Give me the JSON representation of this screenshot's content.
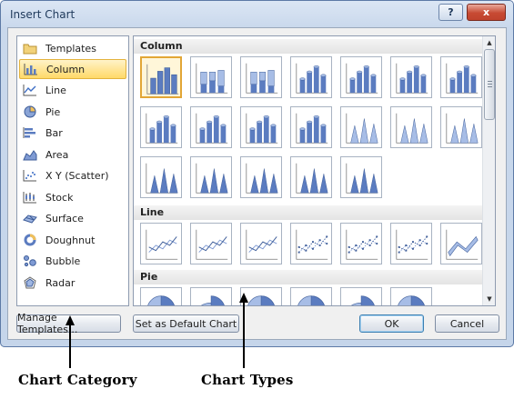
{
  "window": {
    "title": "Insert Chart",
    "help_glyph": "?",
    "close_glyph": "x"
  },
  "categories": [
    {
      "label": "Templates",
      "icon": "templates-folder-icon"
    },
    {
      "label": "Column",
      "icon": "column-chart-icon",
      "selected": true
    },
    {
      "label": "Line",
      "icon": "line-chart-icon"
    },
    {
      "label": "Pie",
      "icon": "pie-chart-icon"
    },
    {
      "label": "Bar",
      "icon": "bar-chart-icon"
    },
    {
      "label": "Area",
      "icon": "area-chart-icon"
    },
    {
      "label": "X Y (Scatter)",
      "icon": "scatter-chart-icon"
    },
    {
      "label": "Stock",
      "icon": "stock-chart-icon"
    },
    {
      "label": "Surface",
      "icon": "surface-chart-icon"
    },
    {
      "label": "Doughnut",
      "icon": "doughnut-chart-icon"
    },
    {
      "label": "Bubble",
      "icon": "bubble-chart-icon"
    },
    {
      "label": "Radar",
      "icon": "radar-chart-icon"
    }
  ],
  "sections": [
    {
      "title": "Column"
    },
    {
      "title": "Line"
    },
    {
      "title": "Pie"
    }
  ],
  "buttons": {
    "manage_templates": "Manage Templates...",
    "set_default": "Set as Default Chart",
    "ok": "OK",
    "cancel": "Cancel"
  },
  "annotations": {
    "left_caption": "Chart Category",
    "right_caption": "Chart Types"
  },
  "colors": {
    "selection_fill": "#ffd968",
    "selection_border": "#e3b33d",
    "bar_blue": "#5b7cc0",
    "close_red": "#c74a33"
  }
}
